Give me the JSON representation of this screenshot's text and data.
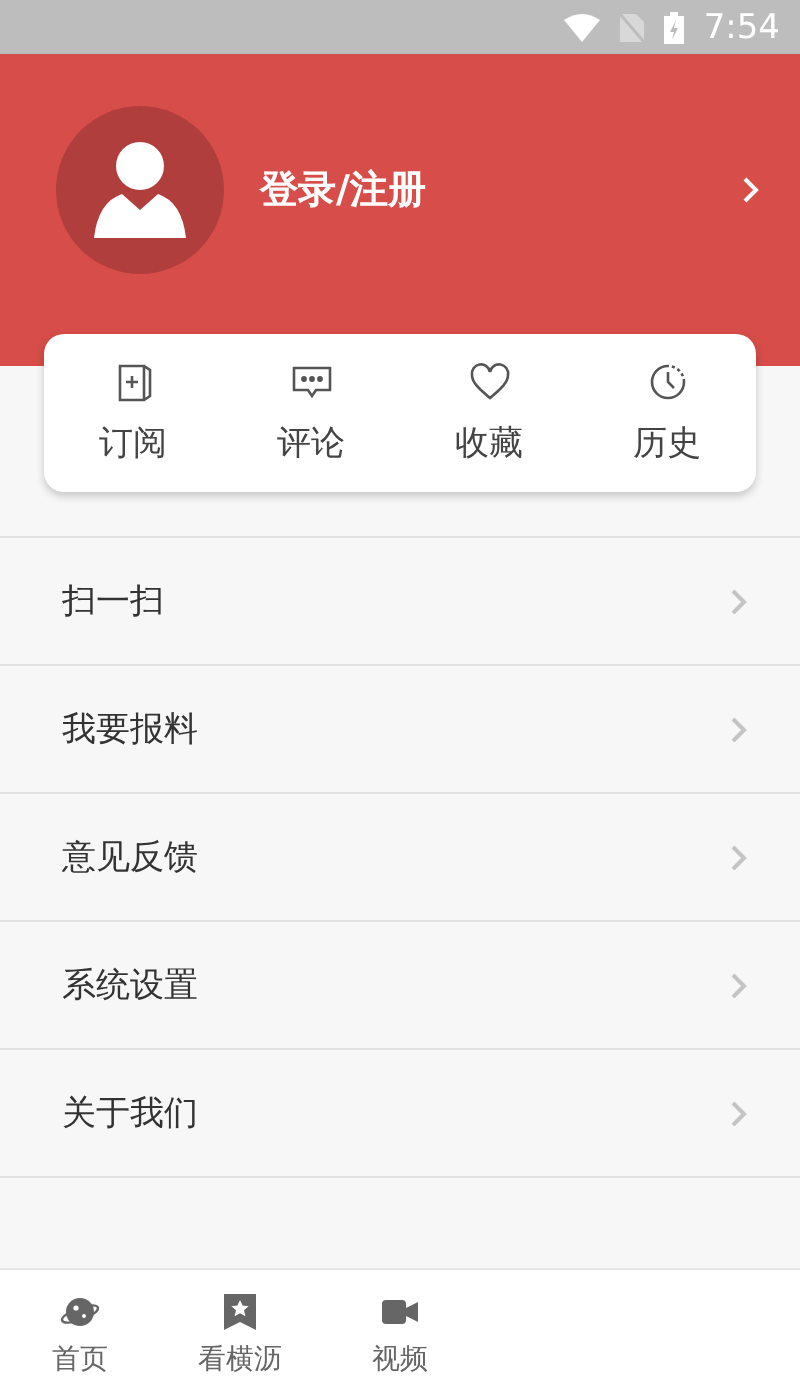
{
  "status_bar": {
    "time": "7:54"
  },
  "profile": {
    "login_label": "登录/注册"
  },
  "quick_actions": [
    {
      "kind": "subscribe",
      "label": "订阅"
    },
    {
      "kind": "comment",
      "label": "评论"
    },
    {
      "kind": "favorite",
      "label": "收藏"
    },
    {
      "kind": "history",
      "label": "历史"
    }
  ],
  "menu": [
    {
      "label": "扫一扫"
    },
    {
      "label": "我要报料"
    },
    {
      "label": "意见反馈"
    },
    {
      "label": "系统设置"
    },
    {
      "label": "关于我们"
    }
  ],
  "bottom_nav": [
    {
      "kind": "home",
      "label": "首页"
    },
    {
      "kind": "bookmark",
      "label": "看横沥"
    },
    {
      "kind": "video",
      "label": "视频"
    }
  ]
}
